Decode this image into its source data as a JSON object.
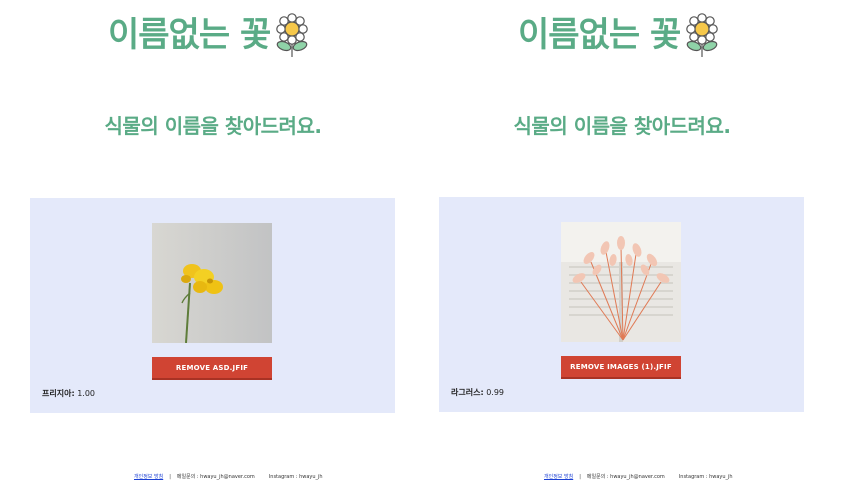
{
  "brand": {
    "title": "이름없는 꽃",
    "icon": "daisy-flower-icon"
  },
  "subtitle": "식물의 이름을 찾아드려요.",
  "colors": {
    "brand_green": "#5aab86",
    "card_bg": "#e4e9fa",
    "remove_red": "#d04433",
    "link_blue": "#1a3fd4"
  },
  "panels": [
    {
      "remove_label": "REMOVE ASD.JFIF",
      "result_name": "프리지아:",
      "result_score": "1.00",
      "photo": "yellow-freesia-photo"
    },
    {
      "remove_label": "REMOVE IMAGES (1).JFIF",
      "result_name": "라그러스:",
      "result_score": "0.99",
      "photo": "dried-lagurus-bouquet-photo"
    }
  ],
  "footer": {
    "policy": "개인정보 방침",
    "separator": "|",
    "contact": "메일문의 : hwayu_jh@naver.com",
    "instagram": "Instagram : hwayu_jh"
  }
}
